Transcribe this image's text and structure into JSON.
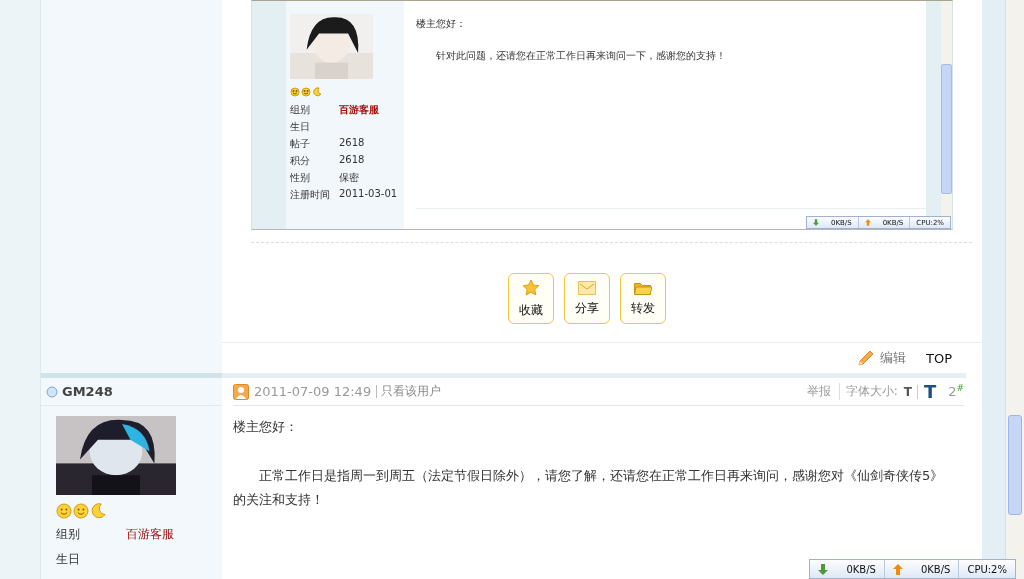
{
  "quoted_screenshot": {
    "kind": "picture_of_screen",
    "profile": [
      {
        "label": "组别",
        "value": "百游客服",
        "kind": "group"
      },
      {
        "label": "生日",
        "kind": "plain"
      },
      {
        "label": "帖子",
        "value": "2618",
        "kind": "plain"
      },
      {
        "label": "积分",
        "value": "2618",
        "kind": "plain"
      },
      {
        "label": "性别",
        "value": "保密",
        "kind": "plain"
      },
      {
        "label": "注册时间",
        "value": "2011-03-01",
        "kind": "plain"
      }
    ],
    "greeting": "楼主您好：",
    "body": "针对此问题，还请您在正常工作日再来询问一下，感谢您的支持！",
    "net_monitor": {
      "download": "0KB/S",
      "upload": "0KB/S",
      "cpu": "CPU:2%"
    }
  },
  "post_actions": [
    {
      "label": "收藏",
      "kind": "star"
    },
    {
      "label": "分享",
      "kind": "envelope"
    },
    {
      "label": "转发",
      "kind": "folder"
    }
  ],
  "post_footer": {
    "edit": "编辑",
    "top": "TOP"
  },
  "post": {
    "author": "GM248",
    "online": false,
    "date": "2011-07-09 12:49",
    "only_author": "只看该用户",
    "report": "举报",
    "font_size_label": "字体大小:",
    "font_sizes": [
      {
        "label": "T",
        "selected": false
      },
      {
        "label": "T",
        "selected": true
      }
    ],
    "floor": "2",
    "floor_mark": "#",
    "profile": [
      {
        "label": "组别",
        "value": "百游客服",
        "kind": "group"
      },
      {
        "label": "生日",
        "kind": "plain"
      }
    ],
    "greeting": "楼主您好：",
    "body": "正常工作日是指周一到周五（法定节假日除外），请您了解，还请您在正常工作日再来询问，感谢您对《仙剑奇侠传5》的关注和支持！"
  },
  "net_monitor": {
    "download": "0KB/S",
    "upload": "0KB/S",
    "cpu": "CPU:2%"
  }
}
